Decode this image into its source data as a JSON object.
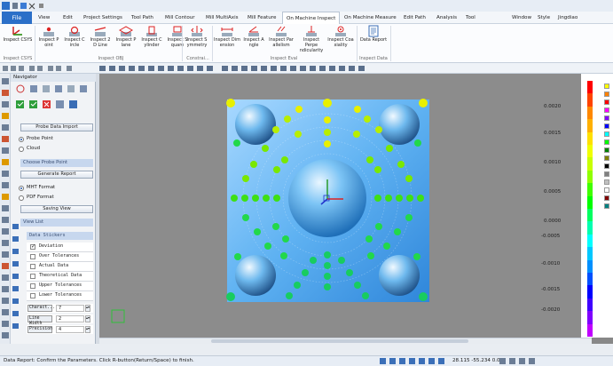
{
  "menu": {
    "file": "File",
    "tabs": [
      "View",
      "Edit",
      "Project Settings",
      "Tool Path",
      "Mill Contour",
      "Mill MultiAxis",
      "Mill Feature",
      "On Machine Inspect",
      "On Machine Measure",
      "Edit Path",
      "Analysis",
      "Tool"
    ],
    "active_tab": "On Machine Inspect",
    "right": [
      "Window",
      "Style",
      "Jingdiao"
    ]
  },
  "ribbon": {
    "buttons": [
      {
        "label": "Inspect CSYS",
        "icon": "csys-icon"
      },
      {
        "label": "Inspect P oint",
        "icon": "point-icon"
      },
      {
        "label": "Inspect C ircle",
        "icon": "circle-icon"
      },
      {
        "label": "Inspect 2 D Line",
        "icon": "line2d-icon"
      },
      {
        "label": "Inspect P lane",
        "icon": "plane-icon"
      },
      {
        "label": "Inspect C ylinder",
        "icon": "cylinder-icon"
      },
      {
        "label": "Inspect S quare",
        "icon": "square-icon"
      },
      {
        "label": "Inspect S ymmetry",
        "icon": "symmetry-icon"
      },
      {
        "label": "Inspect Dim ension",
        "icon": "dimension-icon"
      },
      {
        "label": "Inspect A ngle",
        "icon": "angle-icon"
      },
      {
        "label": "Inspect Par allelism",
        "icon": "parallel-icon"
      },
      {
        "label": "Inspect Perpe ndicularity",
        "icon": "perpendicular-icon"
      },
      {
        "label": "Inspect Coa xiality",
        "icon": "coaxial-icon"
      },
      {
        "label": "Data Report",
        "icon": "report-icon"
      }
    ],
    "groups": [
      "Inspect CSYS",
      "Inspect OBJ",
      "Constrai...",
      "Inspect Eval",
      "Inspect Data"
    ]
  },
  "navigator": {
    "title": "Navigator",
    "probe_import": "Probe Data Import",
    "probe_point": "Probe Point",
    "cloud": "Cloud",
    "choose_probe_point": "Choose Probe Point",
    "generate_report": "Generate Report",
    "mht_format": "MHT Format",
    "pdf_format": "PDF Format",
    "saving_view": "Saving View",
    "view_list": "View List",
    "data_stickers": "Data Stickers",
    "stickers": [
      {
        "label": "Deviation",
        "checked": true
      },
      {
        "label": "Over Tolerances",
        "checked": false
      },
      {
        "label": "Actual Data",
        "checked": false
      },
      {
        "label": "Theoretical Data",
        "checked": false
      },
      {
        "label": "Upper Tolerances",
        "checked": false
      },
      {
        "label": "Lower Tolerances",
        "checked": false
      }
    ],
    "fields": [
      {
        "label": "Charact...",
        "value": "7"
      },
      {
        "label": "Line Width",
        "value": "2"
      },
      {
        "label": "Precision",
        "value": "4"
      }
    ]
  },
  "scale": {
    "labels": [
      "0.0020",
      "0.0015",
      "0.0010",
      "0.0005",
      "0.0000",
      "-0.0005",
      "-0.0010",
      "-0.0015",
      "-0.0020"
    ],
    "colors": [
      "#ff0000",
      "#ff4400",
      "#ff8800",
      "#ffb000",
      "#ffe000",
      "#f0ff00",
      "#c8ff00",
      "#90ff00",
      "#40ff00",
      "#00ff00",
      "#00ff60",
      "#00ffb0",
      "#00ffff",
      "#00c8ff",
      "#0090ff",
      "#0050ff",
      "#0000ff",
      "#4000ff",
      "#8000ff",
      "#c000ff"
    ],
    "swatches": [
      "#ffff00",
      "#ff8000",
      "#ff0000",
      "#ff00ff",
      "#8000ff",
      "#0000ff",
      "#00ffff",
      "#00ff00",
      "#008000",
      "#808000",
      "#000000",
      "#808080",
      "#c0c0c0",
      "#ffffff",
      "#800000",
      "#008080"
    ]
  },
  "status": {
    "message": "Data Report: Confirm the Parameters. Click R-button(Return/Space) to finish.",
    "coords": "28.115 -55.234 0.0"
  }
}
